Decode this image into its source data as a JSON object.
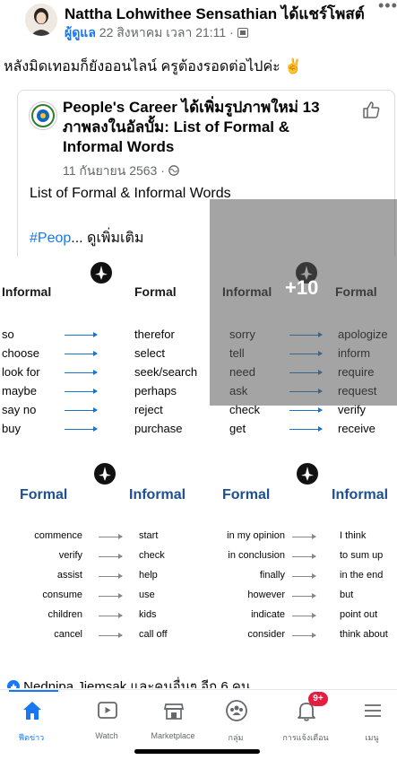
{
  "post": {
    "poster_name": "Nattha Lohwithee Sensathian ได้แชร์โพสต์",
    "role": "ผู้ดูแล",
    "timestamp": "22 สิงหาคม เวลา 21:11 ·",
    "caption": "หลังมิดเทอมก็ยังออนไลน์ ครูต้องรอดต่อไปค่ะ ✌️"
  },
  "shared": {
    "title": "People's Career ได้เพิ่มรูปภาพใหม่ 13 ภาพลงในอัลบั้ม: List of Formal & Informal Words",
    "date": "11 กันยายน 2563 ·",
    "text": "List of Formal & Informal Words",
    "hashtag": "#Peop",
    "see_more": "... ดูเพิ่มเติม"
  },
  "tiles": [
    {
      "left_head": "Informal",
      "right_head": "Formal",
      "left": [
        "so",
        "choose",
        "look for",
        "maybe",
        "say no",
        "buy"
      ],
      "right": [
        "therefor",
        "select",
        "seek/search",
        "perhaps",
        "reject",
        "purchase"
      ]
    },
    {
      "left_head": "Informal",
      "right_head": "Formal",
      "left": [
        "sorry",
        "tell",
        "need",
        "ask",
        "check",
        "get"
      ],
      "right": [
        "apologize",
        "inform",
        "require",
        "request",
        "verify",
        "receive"
      ]
    },
    {
      "left_head": "Formal",
      "right_head": "Informal",
      "left": [
        "commence",
        "verify",
        "assist",
        "consume",
        "children",
        "cancel"
      ],
      "right": [
        "start",
        "check",
        "help",
        "use",
        "kids",
        "call off"
      ]
    },
    {
      "left_head": "Formal",
      "right_head": "Informal",
      "left": [
        "in my opinion",
        "in conclusion",
        "finally",
        "however",
        "indicate",
        "consider"
      ],
      "right": [
        "I think",
        "to sum up",
        "in the end",
        "but",
        "point out",
        "think about"
      ]
    }
  ],
  "more_photos": "+10",
  "likers": "Nednipa Jiemsak และคนอื่นๆ อีก 6 คน",
  "tabbar": {
    "items": [
      {
        "label": "ฟีดข่าว",
        "icon": "home-icon"
      },
      {
        "label": "Watch",
        "icon": "watch-icon"
      },
      {
        "label": "Marketplace",
        "icon": "marketplace-icon"
      },
      {
        "label": "กลุ่ม",
        "icon": "groups-icon"
      },
      {
        "label": "การแจ้งเตือน",
        "icon": "bell-icon"
      },
      {
        "label": "เมนู",
        "icon": "menu-icon"
      }
    ],
    "badge": "9+"
  },
  "colors": {
    "accent": "#1877f2",
    "badge": "#e41e3f",
    "tile_dark_heading": "#1d4f91"
  }
}
